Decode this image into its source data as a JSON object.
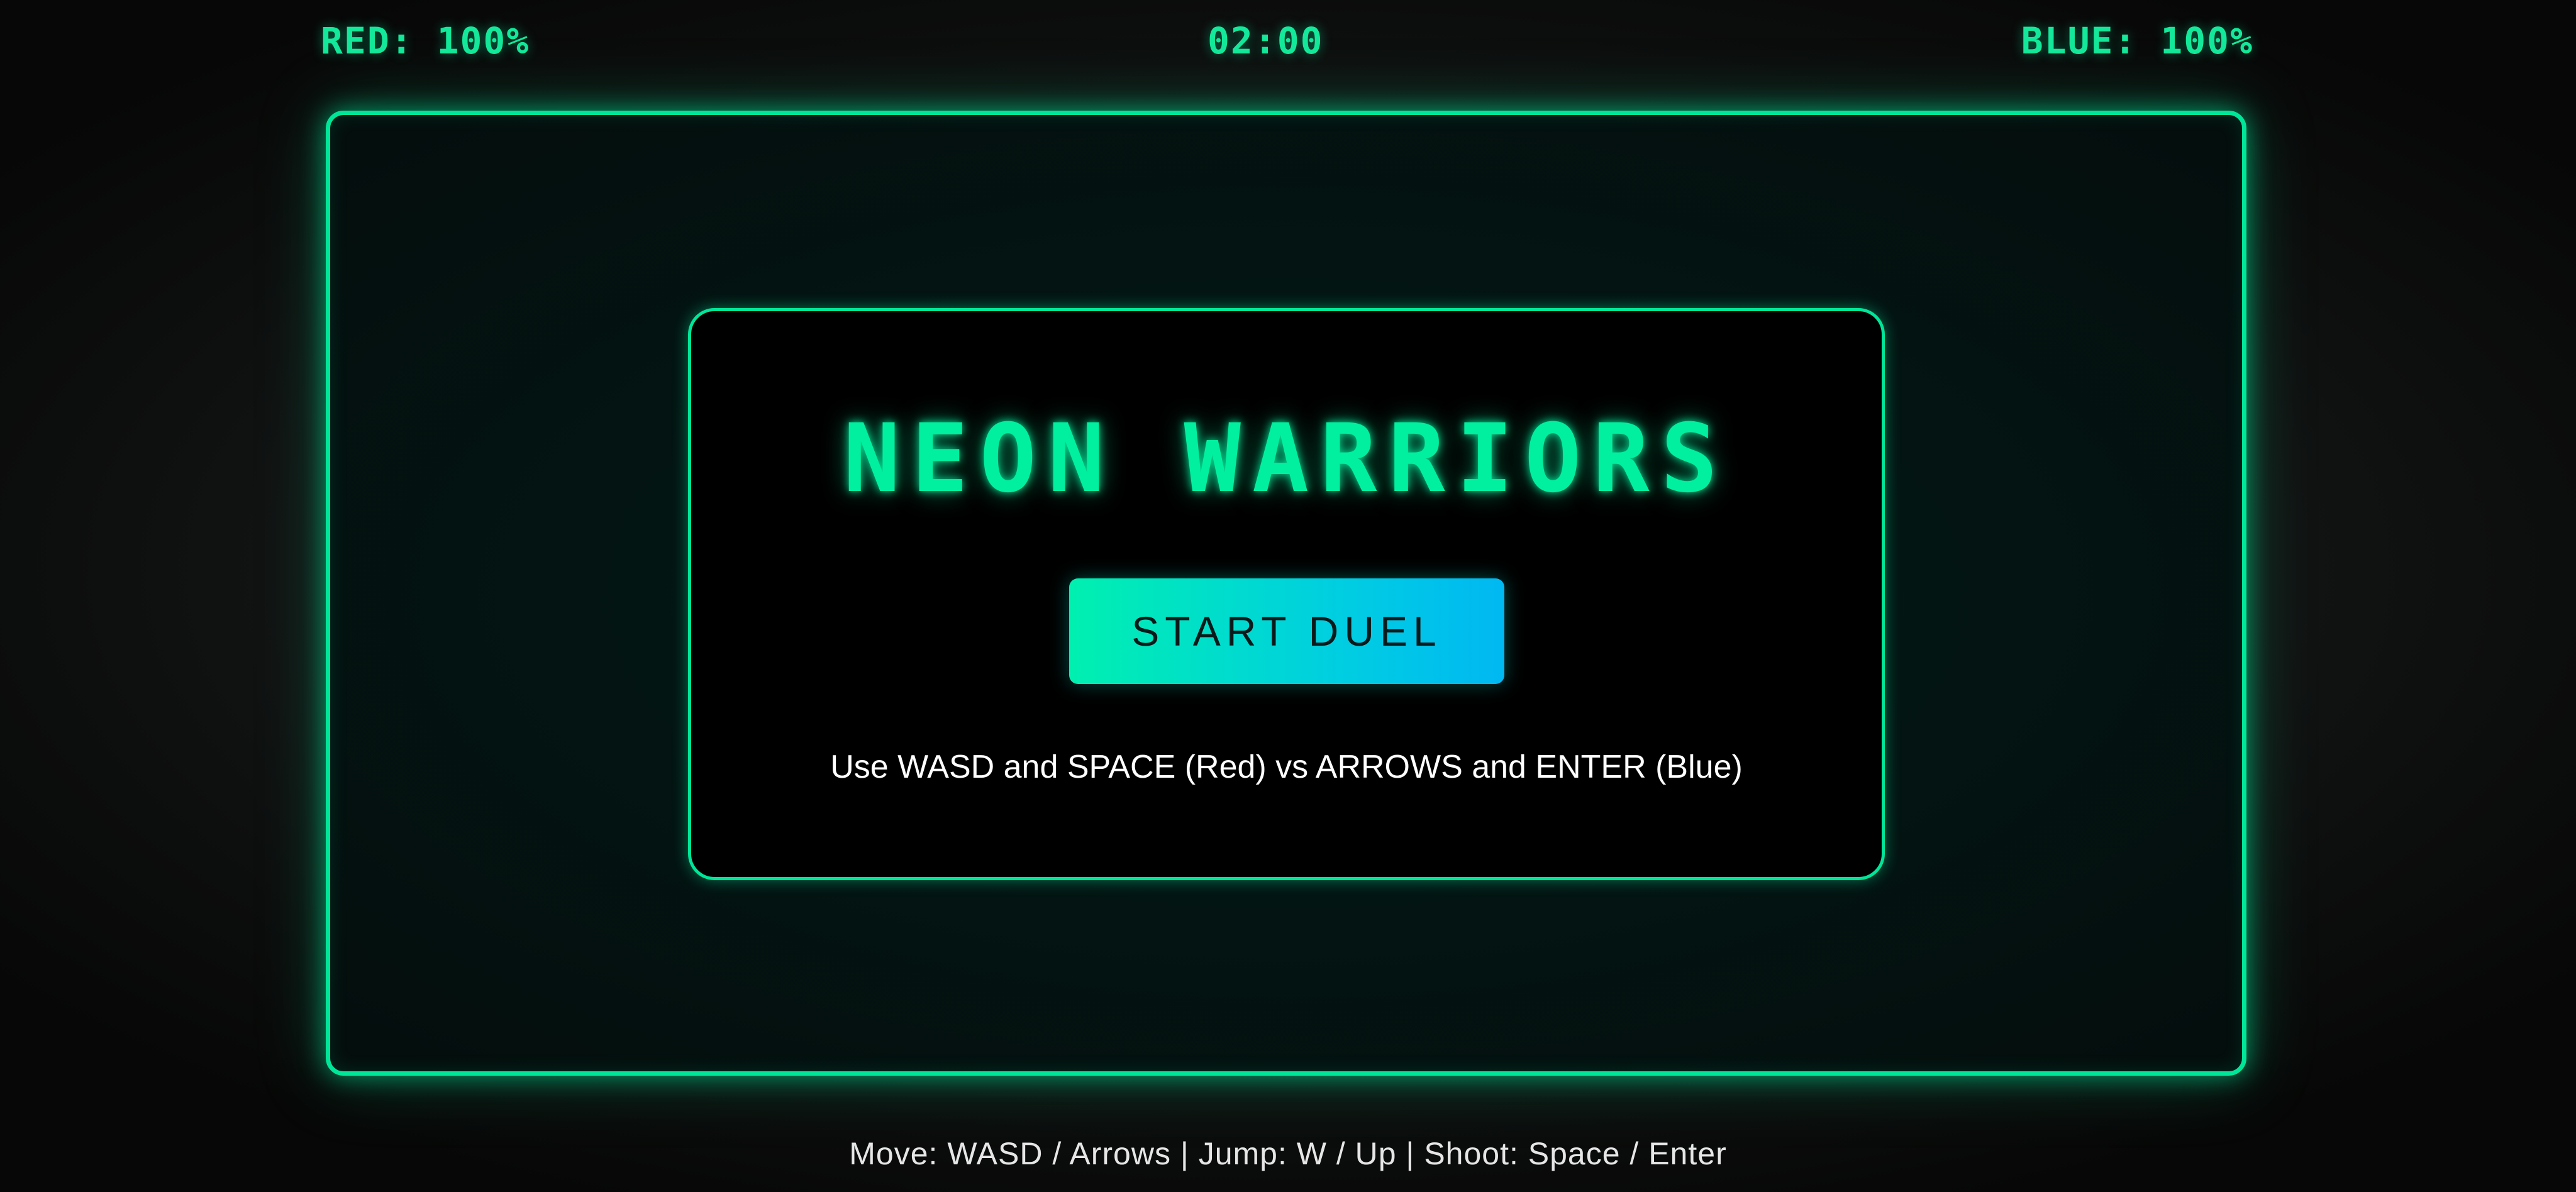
{
  "hud": {
    "red_label": "RED: 100%",
    "timer": "02:00",
    "blue_label": "BLUE: 100%"
  },
  "menu": {
    "title": "NEON WARRIORS",
    "start_button_label": "START DUEL",
    "instructions": "Use WASD and SPACE (Red) vs ARROWS and ENTER (Blue)"
  },
  "footer": {
    "controls_text": "Move: WASD / Arrows | Jump: W / Up | Shoot: Space / Enter"
  },
  "colors": {
    "neon_green": "#00e699",
    "hud_text": "#14e89a",
    "title_text": "#00f0a0",
    "button_gradient_start": "#00f0b0",
    "button_gradient_end": "#00b8f2",
    "button_text": "#0a1a1a",
    "panel_background": "#000000"
  }
}
